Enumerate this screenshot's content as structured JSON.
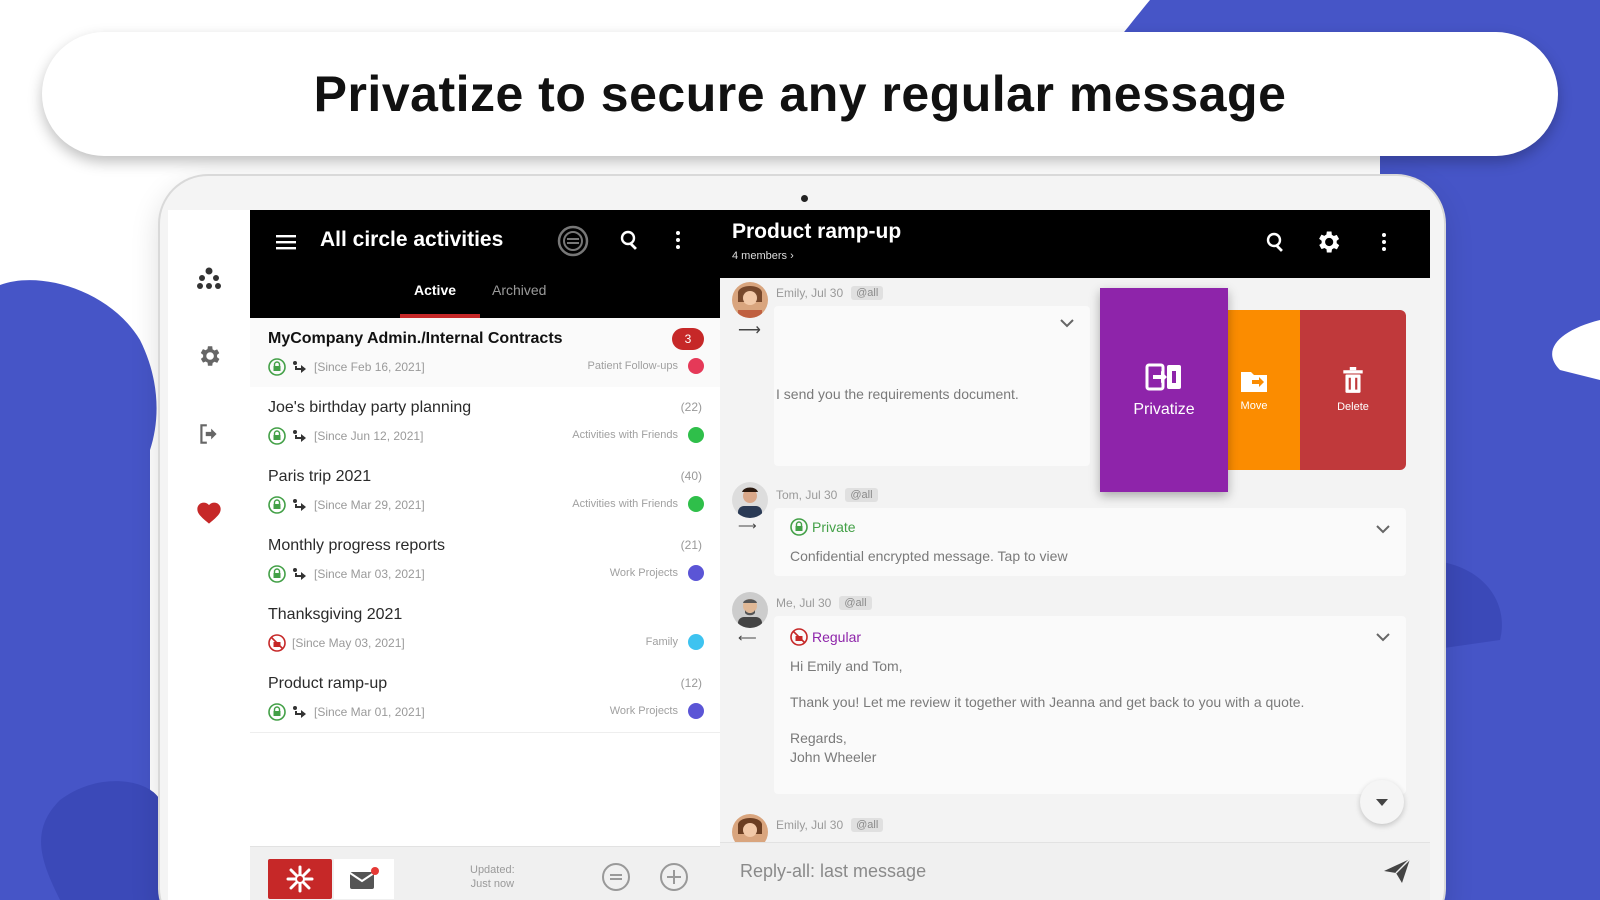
{
  "headline": "Privatize to secure any regular message",
  "colors": {
    "brand_blue": "#4655c7",
    "brand_red": "#c62828",
    "privatize_purple": "#8e24aa",
    "move_orange": "#fb8c00",
    "delete_red": "#c0393b",
    "private_green": "#43a047",
    "regular_purple": "#8e24aa"
  },
  "left_panel": {
    "title": "All circle activities",
    "tabs": [
      {
        "label": "Active",
        "selected": true
      },
      {
        "label": "Archived",
        "selected": false
      }
    ],
    "conversations": [
      {
        "title": "MyCompany Admin./Internal Contracts",
        "badge": "3",
        "count": "",
        "since": "[Since Feb 16, 2021]",
        "circle": "Patient Follow-ups",
        "dot_color": "#e53958",
        "privacy": "private"
      },
      {
        "title": "Joe's birthday party planning",
        "badge": "",
        "count": "(22)",
        "since": "[Since Jun 12, 2021]",
        "circle": "Activities with Friends",
        "dot_color": "#2fbf4a",
        "privacy": "private"
      },
      {
        "title": "Paris trip 2021",
        "badge": "",
        "count": "(40)",
        "since": "[Since Mar 29, 2021]",
        "circle": "Activities with Friends",
        "dot_color": "#2fbf4a",
        "privacy": "private"
      },
      {
        "title": "Monthly progress reports",
        "badge": "",
        "count": "(21)",
        "since": "[Since Mar 03, 2021]",
        "circle": "Work Projects",
        "dot_color": "#5b55d6",
        "privacy": "private"
      },
      {
        "title": "Thanksgiving 2021",
        "badge": "",
        "count": "",
        "since": "[Since May 03, 2021]",
        "circle": "Family",
        "dot_color": "#3ec3f0",
        "privacy": "regular"
      },
      {
        "title": "Product ramp-up",
        "badge": "",
        "count": "(12)",
        "since": "[Since Mar 01, 2021]",
        "circle": "Work Projects",
        "dot_color": "#5b55d6",
        "privacy": "private"
      }
    ],
    "footer": {
      "updated_line1": "Updated:",
      "updated_line2": "Just now"
    }
  },
  "right_panel": {
    "title": "Product ramp-up",
    "subtitle": "4 members ›",
    "messages": [
      {
        "author": "Emily, Jul 30",
        "tag": "@all",
        "text": "I send you the requirements document."
      },
      {
        "author": "Tom, Jul 30",
        "tag": "@all",
        "status": "Private",
        "text": "Confidential encrypted message. Tap to view"
      },
      {
        "author": "Me, Jul 30",
        "tag": "@all",
        "status": "Regular",
        "lines": [
          "Hi Emily and Tom,",
          "Thank you! Let me review it together with Jeanna and get back to you with a quote.",
          "Regards,",
          "John Wheeler"
        ]
      },
      {
        "author": "Emily, Jul 30",
        "tag": "@all"
      }
    ],
    "actions": {
      "privatize": "Privatize",
      "move": "Move",
      "delete": "Delete"
    },
    "reply_placeholder": "Reply-all: last message"
  }
}
